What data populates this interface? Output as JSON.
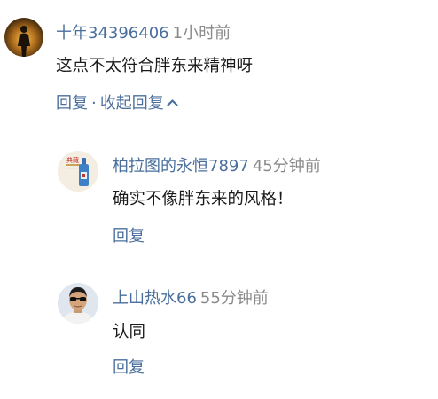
{
  "comments": [
    {
      "username": "十年34396406",
      "time": "1小时前",
      "content": "这点不太符合胖东来精神呀",
      "reply_label": "回复",
      "separator": "·",
      "collapse_label": "收起回复",
      "avatar_icon": "runner-silhouette-avatar"
    }
  ],
  "replies": [
    {
      "username": "柏拉图的永恒7897",
      "time": "45分钟前",
      "content": "确实不像胖东来的风格！",
      "reply_label": "回复",
      "avatar_icon": "liquor-bottle-avatar",
      "avatar_text": "典藏"
    },
    {
      "username": "上山热水66",
      "time": "55分钟前",
      "content": "认同",
      "reply_label": "回复",
      "avatar_icon": "person-sunglasses-avatar"
    }
  ],
  "colors": {
    "link": "#4a6f9c",
    "time": "#8a8a8a",
    "text": "#1a1a1a"
  }
}
